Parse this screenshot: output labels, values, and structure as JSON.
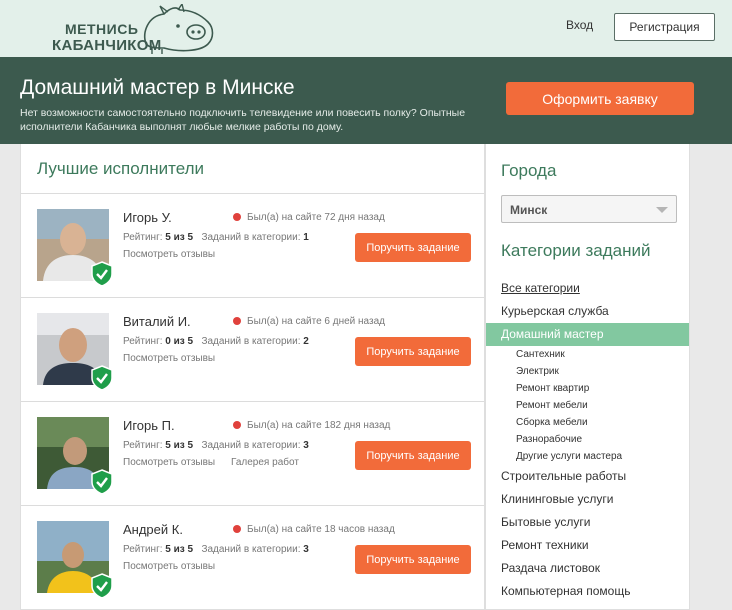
{
  "header": {
    "logo_line1": "МЕТНИСЬ",
    "logo_line2": "КАБАНЧИКОМ",
    "login_label": "Вход",
    "register_label": "Регистрация"
  },
  "banner": {
    "title": "Домашний мастер в Минске",
    "description": "Нет возможности самостоятельно подключить телевидение или повесить полку? Опытные исполнители Кабанчика выполнят любые мелкие работы по дому.",
    "order_button": "Оформить заявку",
    "order_button_color": "#f26b3a"
  },
  "performers": {
    "title": "Лучшие исполнители",
    "items": [
      {
        "name": "Игорь У.",
        "status": "Был(а) на сайте 72 дня назад",
        "rating_label": "Рейтинг:",
        "rating": "5 из 5",
        "tasks_label": "Заданий в категории:",
        "tasks": "1",
        "reviews": "Посмотреть отзывы",
        "gallery": "",
        "button": "Поручить задание"
      },
      {
        "name": "Виталий И.",
        "status": "Был(а) на сайте 6 дней назад",
        "rating_label": "Рейтинг:",
        "rating": "0 из 5",
        "tasks_label": "Заданий в категории:",
        "tasks": "2",
        "reviews": "Посмотреть отзывы",
        "gallery": "",
        "button": "Поручить задание"
      },
      {
        "name": "Игорь П.",
        "status": "Был(а) на сайте 182 дня назад",
        "rating_label": "Рейтинг:",
        "rating": "5 из 5",
        "tasks_label": "Заданий в категории:",
        "tasks": "3",
        "reviews": "Посмотреть отзывы",
        "gallery": "Галерея работ",
        "button": "Поручить задание"
      },
      {
        "name": "Андрей К.",
        "status": "Был(а) на сайте 18 часов назад",
        "rating_label": "Рейтинг:",
        "rating": "5 из 5",
        "tasks_label": "Заданий в категории:",
        "tasks": "3",
        "reviews": "Посмотреть отзывы",
        "gallery": "",
        "button": "Поручить задание"
      }
    ]
  },
  "sidebar": {
    "cities_title": "Города",
    "city_selected": "Минск",
    "categories_title": "Категории заданий",
    "categories": [
      {
        "label": "Все категории"
      },
      {
        "label": "Курьерская служба"
      },
      {
        "label": "Домашний мастер",
        "active": true
      },
      {
        "label": "Сантехник",
        "sub": true
      },
      {
        "label": "Электрик",
        "sub": true
      },
      {
        "label": "Ремонт квартир",
        "sub": true
      },
      {
        "label": "Ремонт мебели",
        "sub": true
      },
      {
        "label": "Сборка мебели",
        "sub": true
      },
      {
        "label": "Разнорабочие",
        "sub": true
      },
      {
        "label": "Другие услуги мастера",
        "sub": true
      },
      {
        "label": "Строительные работы"
      },
      {
        "label": "Клининговые услуги"
      },
      {
        "label": "Бытовые услуги"
      },
      {
        "label": "Ремонт техники"
      },
      {
        "label": "Раздача листовок"
      },
      {
        "label": "Компьютерная помощь"
      }
    ]
  },
  "colors": {
    "brand_dark": "#3c5a4e",
    "accent": "#f26b3a",
    "active_category": "#82c8a0",
    "verified": "#1f9e4a"
  }
}
